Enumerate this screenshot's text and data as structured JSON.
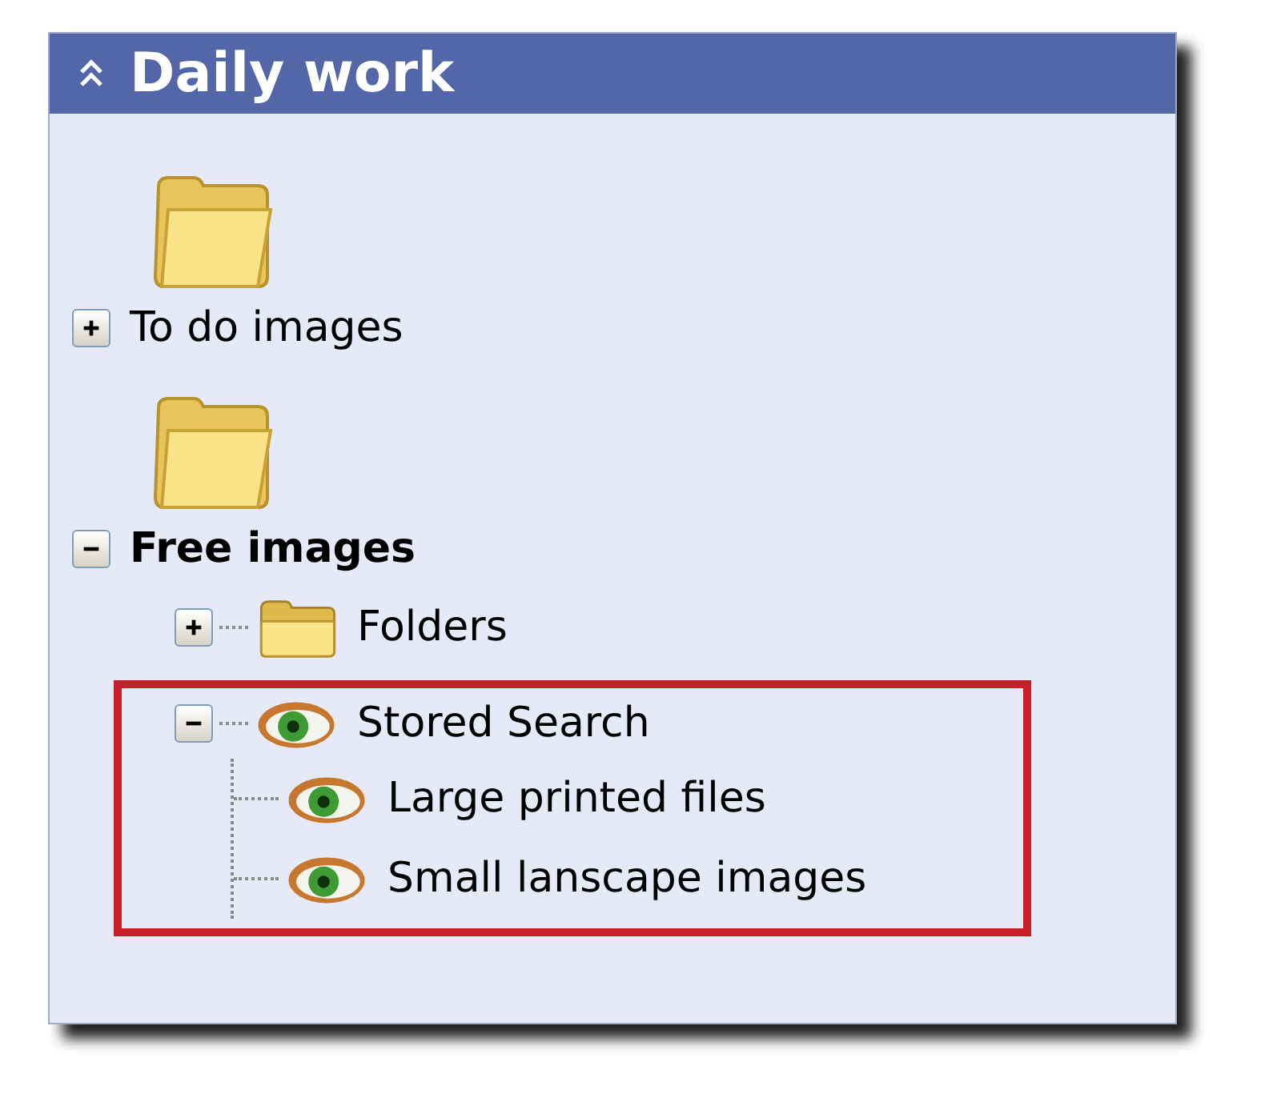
{
  "panel": {
    "title": "Daily work",
    "expanded": true
  },
  "groups": [
    {
      "label": "To do images",
      "expanded": false,
      "selected": false
    },
    {
      "label": "Free images",
      "expanded": true,
      "selected": true,
      "children": [
        {
          "label": "Folders",
          "kind": "folder",
          "expanded": false,
          "highlighted": false
        },
        {
          "label": "Stored Search",
          "kind": "search",
          "expanded": true,
          "highlighted": true,
          "children": [
            {
              "label": "Large printed files",
              "kind": "search"
            },
            {
              "label": "Small lanscape images",
              "kind": "search"
            }
          ]
        }
      ]
    }
  ]
}
